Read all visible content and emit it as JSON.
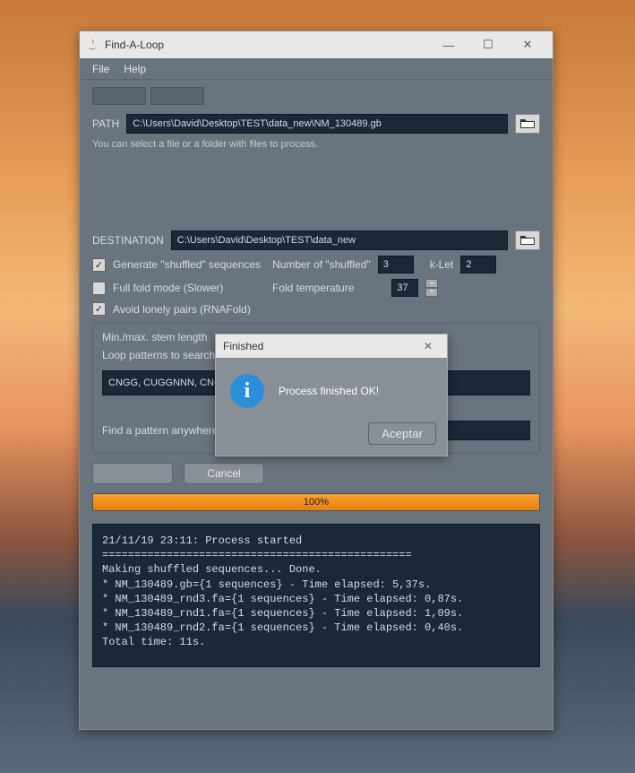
{
  "window": {
    "title": "Find-A-Loop"
  },
  "menu": {
    "file": "File",
    "help": "Help"
  },
  "path": {
    "label": "PATH",
    "value": "C:\\Users\\David\\Desktop\\TEST\\data_new\\NM_130489.gb",
    "hint": "You can select a file or a folder with files to process."
  },
  "destination": {
    "label": "DESTINATION",
    "value": "C:\\Users\\David\\Desktop\\TEST\\data_new"
  },
  "options": {
    "generate_shuffled": "Generate \"shuffled\" sequences",
    "number_shuffled_label": "Number of \"shuffled\"",
    "number_shuffled_value": "3",
    "klet_label": "k-Let",
    "klet_value": "2",
    "full_fold": "Full fold mode (Slower)",
    "fold_temp_label": "Fold temperature",
    "fold_temp_value": "37",
    "avoid_lonely": "Avoid lonely pairs (RNAFold)"
  },
  "stem": {
    "minmax_label": "Min./max. stem length",
    "loop_patterns_label": "Loop patterns to search:",
    "loop_patterns_value": "CNGG, CUGGNNN, CNGG",
    "find_pattern_label": "Find a pattern anywhere:"
  },
  "buttons": {
    "cancel": "Cancel"
  },
  "progress": {
    "text": "100%",
    "percent": 100
  },
  "log": "21/11/19 23:11: Process started\n================================================\nMaking shuffled sequences... Done.\n* NM_130489.gb={1 sequences} - Time elapsed: 5,37s.\n* NM_130489_rnd3.fa={1 sequences} - Time elapsed: 0,87s.\n* NM_130489_rnd1.fa={1 sequences} - Time elapsed: 1,09s.\n* NM_130489_rnd2.fa={1 sequences} - Time elapsed: 0,40s.\nTotal time: 11s.",
  "dialog": {
    "title": "Finished",
    "message": "Process finished OK!",
    "ok": "Aceptar"
  }
}
